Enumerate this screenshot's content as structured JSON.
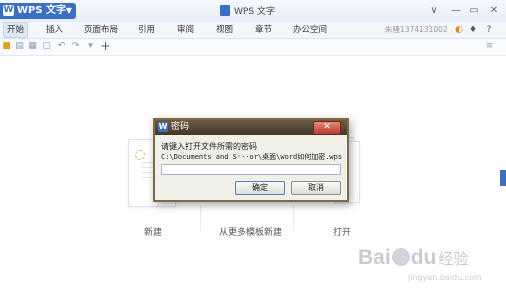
{
  "app": {
    "name": "WPS 文字",
    "window_title": "WPS 文字",
    "account": "朱骚1374131002"
  },
  "menu": {
    "items": [
      "开始",
      "插入",
      "页面布局",
      "引用",
      "审阅",
      "视图",
      "章节",
      "办公空间"
    ]
  },
  "window_controls": {
    "minimize": "—",
    "maximize": "▭",
    "close": "✕",
    "collapse": "∨"
  },
  "quick_toolbar": {
    "icons": [
      "folder-icon",
      "save-icon",
      "print-icon",
      "preview-icon",
      "undo-icon",
      "redo-icon",
      "dropdown-icon",
      "add-icon"
    ]
  },
  "start_page": {
    "new_label": "新建",
    "template_label": "从更多模板新建",
    "open_label": "打开"
  },
  "dialog": {
    "title": "密码",
    "prompt": "请键入打开文件所需的密码",
    "path": "C:\\Documents and S···or\\桌面\\word如何加密.wps",
    "password_value": "",
    "ok_label": "确定",
    "cancel_label": "取消",
    "close_glyph": "✕"
  },
  "watermark": {
    "bai": "Bai",
    "du": "du",
    "jingyan": "经验",
    "url": "jingyan.baidu.com"
  },
  "colors": {
    "accent": "#3b6fc3",
    "dialog_frame": "#7e6a45",
    "close_red": "#b8382b"
  }
}
